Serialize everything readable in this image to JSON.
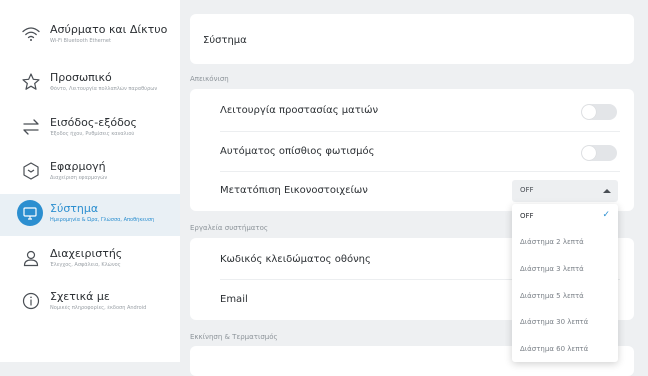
{
  "sidebar": {
    "items": [
      {
        "title": "Ασύρματο και Δίκτυο",
        "subtitle": "Wi-Fi Bluetooth Ethernet",
        "icon": "wifi-icon"
      },
      {
        "title": "Προσωπικό",
        "subtitle": "Φόντο, Λειτουργία πολλαπλών παραθύρων",
        "icon": "star-icon"
      },
      {
        "title": "Εισόδος-εξόδος",
        "subtitle": "Έξοδος ήχου, Ρυθμίσεις καναλιού",
        "icon": "swap-arrows-icon"
      },
      {
        "title": "Εφαρμογή",
        "subtitle": "Διαχείριση εφαρμογών",
        "icon": "app-icon"
      },
      {
        "title": "Σύστημα",
        "subtitle": "Ημερομηνία & Ώρα, Γλώσσα, Αποθήκευση",
        "icon": "monitor-icon"
      },
      {
        "title": "Διαχειριστής",
        "subtitle": "Έλεγχος, Ασφάλεια, Κλώνος",
        "icon": "user-icon"
      },
      {
        "title": "Σχετικά με",
        "subtitle": "Νομικές πληροφορίες, έκδοση Android",
        "icon": "info-icon"
      }
    ]
  },
  "main": {
    "header_title": "Σύστημα",
    "display_section": "Απεικόνιση",
    "eye_protection": "Λειτουργία προστασίας ματιών",
    "auto_backlight": "Αυτόματος οπίσθιος φωτισμός",
    "pixel_shift": "Μετατόπιση Εικονοστοιχείων",
    "pixel_shift_value": "OFF",
    "tools_section": "Εργαλεία συστήματος",
    "lock_password": "Κωδικός κλειδώματος οθόνης",
    "email": "Email",
    "startup_section": "Εκκίνηση & Τερματισμός"
  },
  "dropdown": {
    "options": [
      "OFF",
      "Διάστημα 2 λεπτά",
      "Διάστημα 3 λεπτά",
      "Διάστημα 5 λεπτά",
      "Διάστημα 30 λεπτά",
      "Διάστημα 60 λεπτά"
    ],
    "selected": "OFF"
  },
  "colors": {
    "accent": "#2c8fd0",
    "background": "#eef0f2",
    "toggle_off": "#e3e5e8"
  }
}
